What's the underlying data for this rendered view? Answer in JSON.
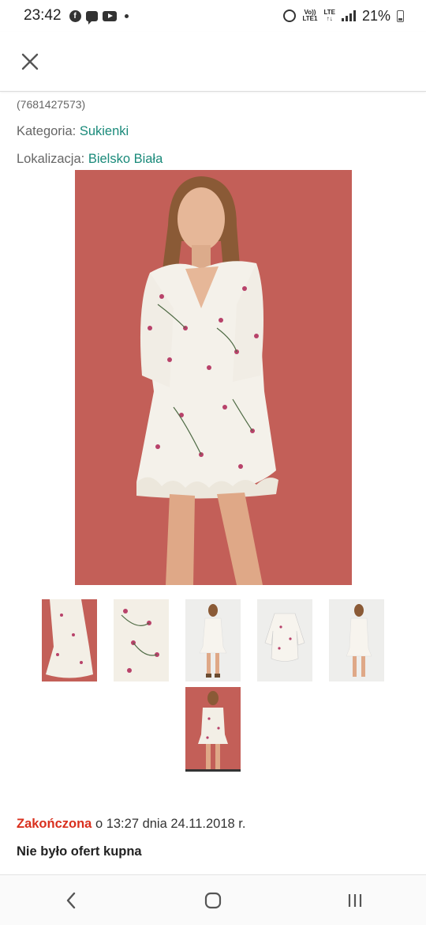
{
  "status_bar": {
    "time": "23:42",
    "fb_glyph": "f",
    "volte_line1": "Vo))",
    "volte_line2": "LTE1",
    "lte_line1": "LTE",
    "lte_line2": "↑↓",
    "battery_percent": "21%",
    "icons": [
      "facebook-icon",
      "chat-icon",
      "youtube-icon",
      "alarm-icon",
      "signal-icon",
      "battery-icon"
    ]
  },
  "app_bar": {
    "close_icon": "close-icon"
  },
  "listing": {
    "item_id": "(7681427573)",
    "category_label": "Kategoria:",
    "category_value": "Sukienki",
    "location_label": "Lokalizacja:",
    "location_value": "Bielsko Biała"
  },
  "gallery": {
    "main_image": "woman-in-floral-dress-photo",
    "thumbnails": [
      {
        "name": "thumbnail-1",
        "style": "red",
        "active": false
      },
      {
        "name": "thumbnail-2",
        "style": "light",
        "active": false
      },
      {
        "name": "thumbnail-3",
        "style": "light",
        "active": false
      },
      {
        "name": "thumbnail-4",
        "style": "light",
        "active": false
      },
      {
        "name": "thumbnail-5",
        "style": "light",
        "active": false
      },
      {
        "name": "thumbnail-6",
        "style": "red",
        "active": true
      }
    ]
  },
  "auction": {
    "status_label": "Zakończona",
    "status_rest": " o 13:27 dnia 24.11.2018 r.",
    "offers_text": "Nie było ofert kupna"
  },
  "colors": {
    "accent_link": "#1a8a7a",
    "ended_red": "#d9301e",
    "photo_bg": "#c35f58"
  },
  "nav_bar": {
    "buttons": [
      "back-icon",
      "home-icon",
      "recents-icon"
    ]
  }
}
